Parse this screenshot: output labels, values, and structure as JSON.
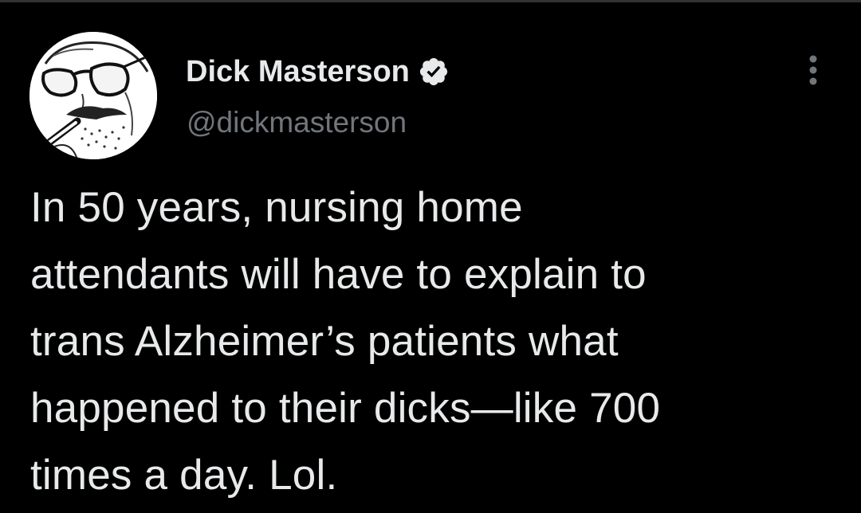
{
  "author": {
    "display_name": "Dick Masterson",
    "handle": "@dickmasterson",
    "verified": true,
    "avatar_icon": "sketch-portrait-with-aviator-glasses-and-cigarette"
  },
  "tweet": {
    "text": "In 50 years, nursing home\nattendants will have to explain to\ntrans Alzheimer’s patients what\nhappened to their dicks—like 700\ntimes a day. Lol."
  },
  "colors": {
    "background": "#000000",
    "primary_text": "#e7e9ea",
    "secondary_text": "#71767b",
    "verified_badge": "#e7e9ea"
  },
  "icons": {
    "verified": "verified-badge-icon",
    "more": "more-options-icon"
  }
}
